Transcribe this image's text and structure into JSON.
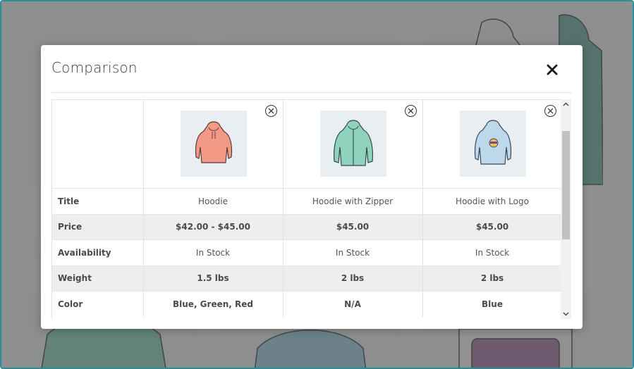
{
  "modal": {
    "title": "Comparison"
  },
  "comparison": {
    "rows": [
      {
        "label": "Title",
        "values": [
          "Hoodie",
          "Hoodie with Zipper",
          "Hoodie with Logo"
        ]
      },
      {
        "label": "Price",
        "values": [
          "$42.00 - $45.00",
          "$45.00",
          "$45.00"
        ]
      },
      {
        "label": "Availability",
        "values": [
          "In Stock",
          "In Stock",
          "In Stock"
        ]
      },
      {
        "label": "Weight",
        "values": [
          "1.5 lbs",
          "2 lbs",
          "2 lbs"
        ]
      },
      {
        "label": "Color",
        "values": [
          "Blue, Green, Red",
          "N/A",
          "Blue"
        ]
      }
    ]
  },
  "products": [
    {
      "image_icon": "hoodie-icon",
      "color": "#f29a86"
    },
    {
      "image_icon": "hoodie-with-zipper-icon",
      "color": "#8fd3bf"
    },
    {
      "image_icon": "hoodie-with-logo-icon",
      "color": "#bcd8ea"
    }
  ],
  "theme": {
    "frame_border": "#2a8e9a",
    "shade_row": "#eeeeee"
  }
}
